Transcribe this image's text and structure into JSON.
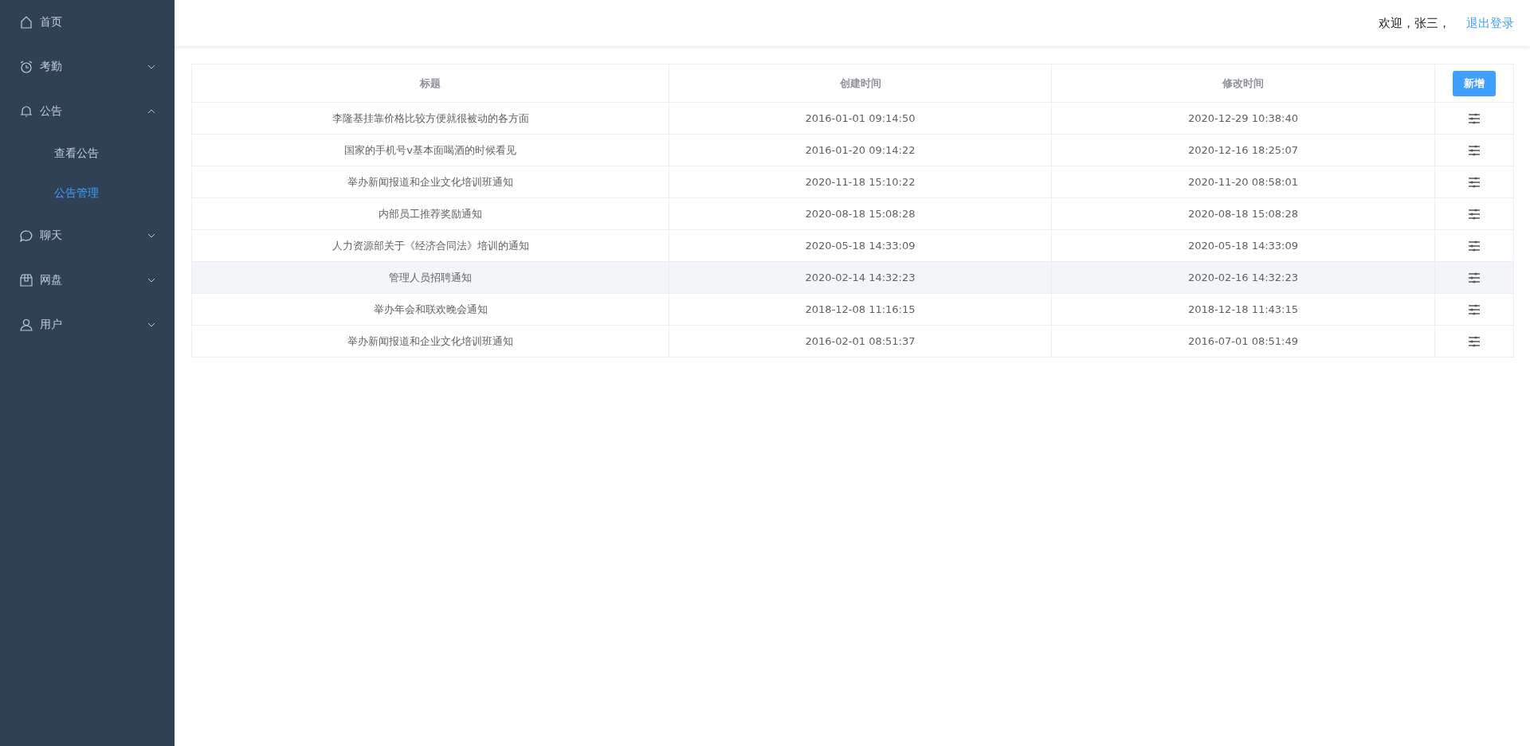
{
  "sidebar": {
    "items": [
      {
        "label": "首页",
        "has_children": false
      },
      {
        "label": "考勤",
        "has_children": true,
        "expanded": false
      },
      {
        "label": "公告",
        "has_children": true,
        "expanded": true,
        "children": [
          {
            "label": "查看公告",
            "selected": false
          },
          {
            "label": "公告管理",
            "selected": true
          }
        ]
      },
      {
        "label": "聊天",
        "has_children": true,
        "expanded": false
      },
      {
        "label": "网盘",
        "has_children": true,
        "expanded": false
      },
      {
        "label": "用户",
        "has_children": true,
        "expanded": false
      }
    ]
  },
  "header": {
    "welcome": "欢迎，张三，",
    "logout": "退出登录"
  },
  "table": {
    "columns": [
      "标题",
      "创建时间",
      "修改时间"
    ],
    "add_button": "新增",
    "rows": [
      {
        "title": "李隆基挂靠价格比较方便就很被动的各方面",
        "created": "2016-01-01 09:14:50",
        "modified": "2020-12-29 10:38:40",
        "highlighted": false
      },
      {
        "title": "国家的手机号v基本面喝酒的时候看见",
        "created": "2016-01-20 09:14:22",
        "modified": "2020-12-16 18:25:07",
        "highlighted": false
      },
      {
        "title": "举办新闻报道和企业文化培训班通知",
        "created": "2020-11-18 15:10:22",
        "modified": "2020-11-20 08:58:01",
        "highlighted": false
      },
      {
        "title": "内部员工推荐奖励通知",
        "created": "2020-08-18 15:08:28",
        "modified": "2020-08-18 15:08:28",
        "highlighted": false
      },
      {
        "title": "人力资源部关于《经济合同法》培训的通知",
        "created": "2020-05-18 14:33:09",
        "modified": "2020-05-18 14:33:09",
        "highlighted": false
      },
      {
        "title": "管理人员招聘通知",
        "created": "2020-02-14 14:32:23",
        "modified": "2020-02-16 14:32:23",
        "highlighted": true
      },
      {
        "title": "举办年会和联欢晚会通知",
        "created": "2018-12-08 11:16:15",
        "modified": "2018-12-18 11:43:15",
        "highlighted": false
      },
      {
        "title": "举办新闻报道和企业文化培训班通知",
        "created": "2016-02-01 08:51:37",
        "modified": "2016-07-01 08:51:49",
        "highlighted": false
      }
    ]
  }
}
